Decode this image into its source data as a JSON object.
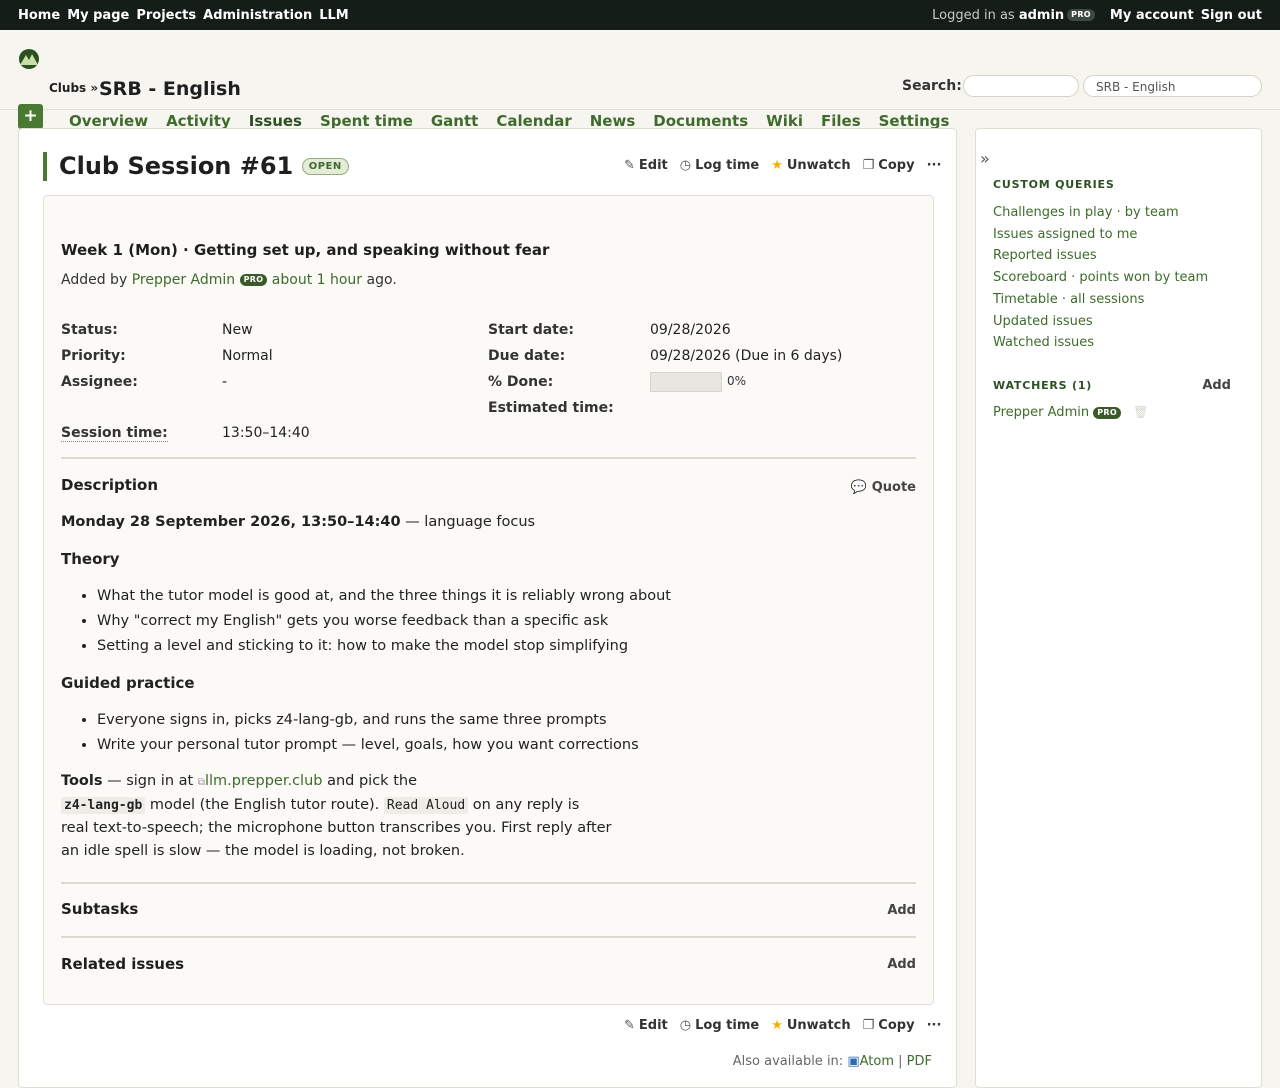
{
  "top_menu": {
    "items": [
      "Home",
      "My page",
      "Projects",
      "Administration",
      "LLM"
    ],
    "logged_prefix": "Logged in as",
    "username": "admin",
    "pro_badge": "PRO",
    "my_account": "My account",
    "sign_out": "Sign out"
  },
  "header": {
    "breadcrumb": "Clubs »",
    "project_title": "SRB - English",
    "search_label": "Search:",
    "search_placeholder": "",
    "project_jump": "SRB - English",
    "plus_label": "+"
  },
  "main_menu": {
    "tabs": [
      "Overview",
      "Activity",
      "Issues",
      "Spent time",
      "Gantt",
      "Calendar",
      "News",
      "Documents",
      "Wiki",
      "Files",
      "Settings"
    ],
    "selected": "Issues"
  },
  "actions": {
    "edit": "Edit",
    "log_time": "Log time",
    "unwatch": "Unwatch",
    "copy": "Copy",
    "more": "···"
  },
  "issue": {
    "title": "Club Session #61",
    "status_badge": "OPEN",
    "subject": "Week 1 (Mon) · Getting set up, and speaking without fear",
    "added_by_prefix": "Added by",
    "author": "Prepper Admin",
    "author_badge": "PRO",
    "time_ago": "about 1 hour",
    "ago_suffix": "ago.",
    "attributes": {
      "status_label": "Status:",
      "status": "New",
      "priority_label": "Priority:",
      "priority": "Normal",
      "assignee_label": "Assignee:",
      "assignee": "-",
      "start_label": "Start date:",
      "start": "09/28/2026",
      "due_label": "Due date:",
      "due": "09/28/2026 (Due in 6 days)",
      "done_label": "% Done:",
      "done_text": "0%",
      "done_fraction": 0,
      "estimated_label": "Estimated time:",
      "estimated": "",
      "session_label": "Session time:",
      "session": "13:50–14:40"
    },
    "description": {
      "heading": "Description",
      "quote": "Quote",
      "date_line_bold": "Monday 28 September 2026, 13:50–14:40",
      "date_line_rest": " — language focus",
      "theory_heading": "Theory",
      "theory_items": [
        "What the tutor model is good at, and the three things it is reliably wrong about",
        "Why \"correct my English\" gets you worse feedback than a specific ask",
        "Setting a level and sticking to it: how to make the model stop simplifying"
      ],
      "practice_heading": "Guided practice",
      "practice_items": [
        "Everyone signs in, picks z4-lang-gb, and runs the same three prompts",
        "Write your personal tutor prompt — level, goals, how you want corrections"
      ],
      "tools_bold": "Tools",
      "tools_t1": " — sign in at ",
      "tools_link": "llm.prepper.club",
      "tools_t2": " and pick the",
      "tools_code1": "z4-lang-gb",
      "tools_t3": " model (the English tutor route). ",
      "tools_code2": "Read Aloud",
      "tools_t4": " on any reply is",
      "tools_line3": "real text-to-speech; the microphone button transcribes you. First reply after",
      "tools_line4": "an idle spell is slow — the model is loading, not broken."
    },
    "subtasks": "Subtasks",
    "related": "Related issues",
    "add": "Add"
  },
  "footer": {
    "also_available": "Also available in:",
    "atom": "Atom",
    "pipe": "|",
    "pdf": "PDF"
  },
  "sidebar": {
    "collapse": "»",
    "custom_queries_title": "CUSTOM QUERIES",
    "queries": [
      "Challenges in play · by team",
      "Issues assigned to me",
      "Reported issues",
      "Scoreboard · points won by team",
      "Timetable · all sessions",
      "Updated issues",
      "Watched issues"
    ],
    "watchers_title": "WATCHERS (1)",
    "watchers_add": "Add",
    "watcher_name": "Prepper Admin",
    "watcher_badge": "PRO"
  },
  "colors": {
    "topbar": "#141d18",
    "accent": "#3f6b2c",
    "button": "#4a7a32"
  }
}
